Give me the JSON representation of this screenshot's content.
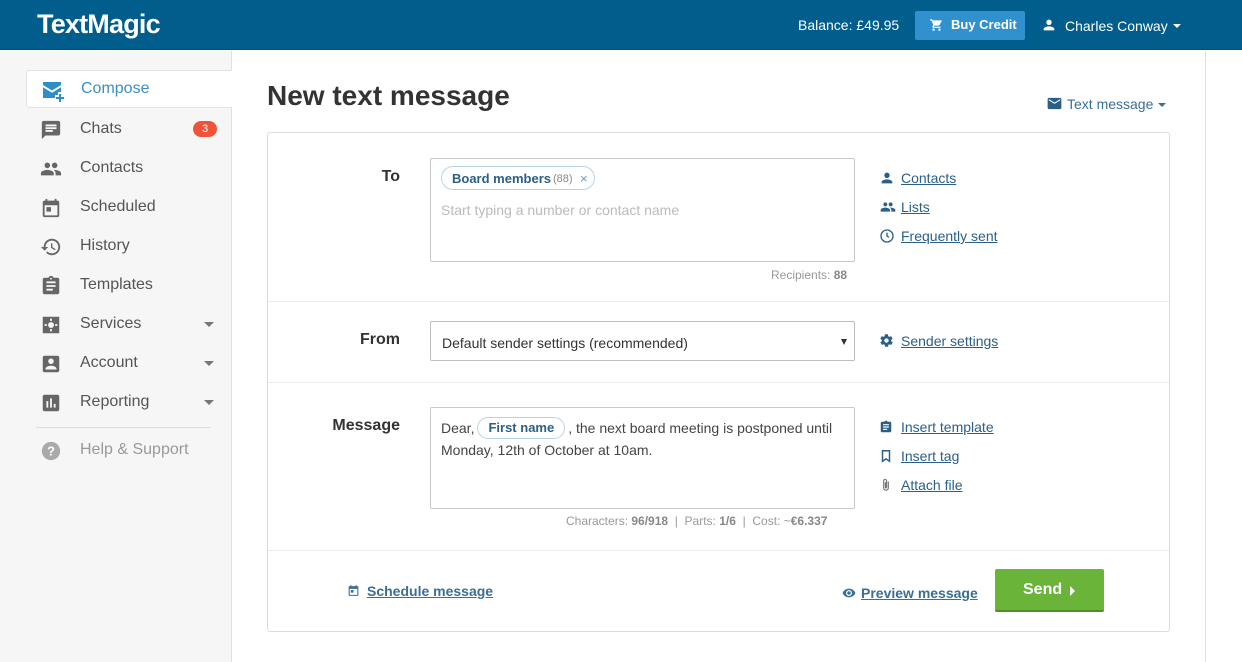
{
  "header": {
    "logo": "TextMagic",
    "balance": "Balance: £49.95",
    "buy_credit": "Buy Credit",
    "user_name": "Charles Conway"
  },
  "sidebar": {
    "items": [
      {
        "label": "Compose",
        "icon": "compose-icon"
      },
      {
        "label": "Chats",
        "icon": "chat-icon",
        "badge": "3"
      },
      {
        "label": "Contacts",
        "icon": "contacts-icon"
      },
      {
        "label": "Scheduled",
        "icon": "calendar-icon"
      },
      {
        "label": "History",
        "icon": "history-icon"
      },
      {
        "label": "Templates",
        "icon": "clipboard-icon"
      },
      {
        "label": "Services",
        "icon": "gear-icon"
      },
      {
        "label": "Account",
        "icon": "account-icon"
      },
      {
        "label": "Reporting",
        "icon": "bar-chart-icon"
      },
      {
        "label": "Help & Support",
        "icon": "help-icon"
      }
    ]
  },
  "main": {
    "title": "New text message",
    "message_type": "Text message",
    "to": {
      "label": "To",
      "chip_name": "Board members",
      "chip_count": "(88)",
      "chip_remove": "×",
      "placeholder": "Start typing a number or contact name",
      "recipients_label": "Recipients:",
      "recipients_count": "88",
      "links": [
        "Contacts",
        "Lists",
        "Frequently sent"
      ]
    },
    "from": {
      "label": "From",
      "selected": "Default sender settings (recommended)",
      "link": "Sender settings"
    },
    "message": {
      "label": "Message",
      "text_before": "Dear,",
      "tag": "First name",
      "text_after": ", the next board meeting is postponed until Monday, 12th of October at 10am.",
      "characters_label": "Characters:",
      "characters": "96/918",
      "parts_label": "Parts:",
      "parts": "1/6",
      "cost_label": "Cost: ~",
      "cost": "€6.337",
      "separator": "|",
      "links": [
        "Insert template",
        "Insert tag",
        "Attach file"
      ]
    },
    "footer": {
      "schedule": "Schedule message",
      "preview": "Preview message",
      "send": "Send"
    }
  },
  "colors": {
    "header_bg": "#015d8c",
    "buy_button": "#3191cf",
    "send_button": "#6ab43a",
    "badge": "#f0533a",
    "link": "#2b5f86"
  }
}
